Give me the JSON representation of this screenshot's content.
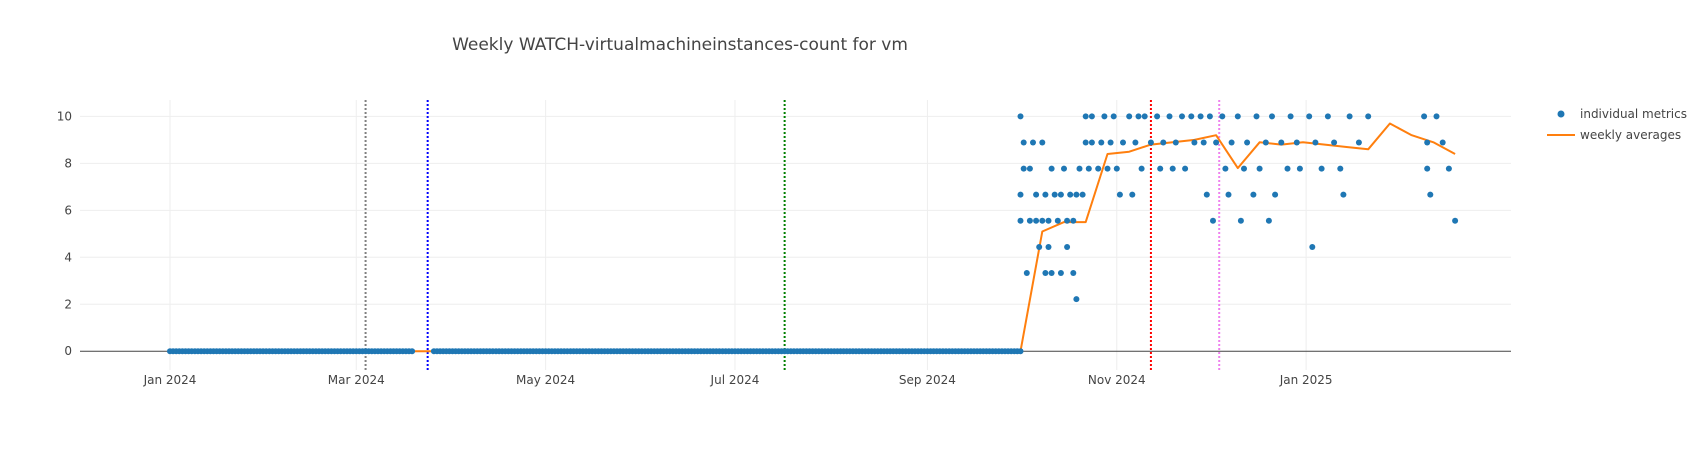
{
  "chart_data": {
    "type": "scatter",
    "title": "Weekly WATCH-virtualmachineinstances-count for vm",
    "xlabel": "",
    "ylabel": "",
    "x_axis": {
      "type": "date",
      "range": [
        "2023-12-03",
        "2025-03-08"
      ],
      "ticks": [
        {
          "date": "2024-01-01",
          "label": "Jan 2024"
        },
        {
          "date": "2024-03-01",
          "label": "Mar 2024"
        },
        {
          "date": "2024-05-01",
          "label": "May 2024"
        },
        {
          "date": "2024-07-01",
          "label": "Jul 2024"
        },
        {
          "date": "2024-09-01",
          "label": "Sep 2024"
        },
        {
          "date": "2024-11-01",
          "label": "Nov 2024"
        },
        {
          "date": "2025-01-01",
          "label": "Jan 2025"
        }
      ]
    },
    "y_axis": {
      "range": [
        -0.8,
        10.7
      ],
      "ticks": [
        0,
        2,
        4,
        6,
        8,
        10
      ]
    },
    "grid": true,
    "legend_position": "top-right",
    "series": [
      {
        "name": "individual metrics",
        "type": "scatter",
        "color": "#1f77b4",
        "zero_segments": [
          {
            "start": "2024-01-01",
            "end": "2024-03-19"
          },
          {
            "start": "2024-03-26",
            "end": "2024-10-01"
          }
        ],
        "points": [
          [
            "2024-10-01",
            10
          ],
          [
            "2024-10-01",
            5.56
          ],
          [
            "2024-10-01",
            6.67
          ],
          [
            "2024-10-02",
            8.89
          ],
          [
            "2024-10-02",
            7.78
          ],
          [
            "2024-10-03",
            3.33
          ],
          [
            "2024-10-04",
            7.78
          ],
          [
            "2024-10-04",
            5.56
          ],
          [
            "2024-10-05",
            8.89
          ],
          [
            "2024-10-06",
            6.67
          ],
          [
            "2024-10-06",
            5.56
          ],
          [
            "2024-10-07",
            4.44
          ],
          [
            "2024-10-08",
            8.89
          ],
          [
            "2024-10-08",
            5.56
          ],
          [
            "2024-10-09",
            3.33
          ],
          [
            "2024-10-09",
            6.67
          ],
          [
            "2024-10-10",
            5.56
          ],
          [
            "2024-10-10",
            4.44
          ],
          [
            "2024-10-11",
            7.78
          ],
          [
            "2024-10-11",
            3.33
          ],
          [
            "2024-10-12",
            6.67
          ],
          [
            "2024-10-13",
            5.56
          ],
          [
            "2024-10-14",
            6.67
          ],
          [
            "2024-10-14",
            3.33
          ],
          [
            "2024-10-15",
            7.78
          ],
          [
            "2024-10-16",
            5.56
          ],
          [
            "2024-10-16",
            4.44
          ],
          [
            "2024-10-17",
            6.67
          ],
          [
            "2024-10-18",
            5.56
          ],
          [
            "2024-10-18",
            3.33
          ],
          [
            "2024-10-19",
            2.22
          ],
          [
            "2024-10-19",
            6.67
          ],
          [
            "2024-10-20",
            7.78
          ],
          [
            "2024-10-21",
            6.67
          ],
          [
            "2024-10-22",
            8.89
          ],
          [
            "2024-10-22",
            10
          ],
          [
            "2024-10-23",
            7.78
          ],
          [
            "2024-10-24",
            10
          ],
          [
            "2024-10-24",
            8.89
          ],
          [
            "2024-10-26",
            7.78
          ],
          [
            "2024-10-27",
            8.89
          ],
          [
            "2024-10-28",
            10
          ],
          [
            "2024-10-29",
            7.78
          ],
          [
            "2024-10-30",
            8.89
          ],
          [
            "2024-10-31",
            10
          ],
          [
            "2024-11-01",
            7.78
          ],
          [
            "2024-11-02",
            6.67
          ],
          [
            "2024-11-03",
            8.89
          ],
          [
            "2024-11-05",
            10
          ],
          [
            "2024-11-06",
            6.67
          ],
          [
            "2024-11-07",
            8.89
          ],
          [
            "2024-11-08",
            10
          ],
          [
            "2024-11-09",
            7.78
          ],
          [
            "2024-11-10",
            10
          ],
          [
            "2024-11-12",
            8.89
          ],
          [
            "2024-11-14",
            10
          ],
          [
            "2024-11-15",
            7.78
          ],
          [
            "2024-11-16",
            8.89
          ],
          [
            "2024-11-18",
            10
          ],
          [
            "2024-11-19",
            7.78
          ],
          [
            "2024-11-20",
            8.89
          ],
          [
            "2024-11-22",
            10
          ],
          [
            "2024-11-23",
            7.78
          ],
          [
            "2024-11-25",
            10
          ],
          [
            "2024-11-26",
            8.89
          ],
          [
            "2024-11-28",
            10
          ],
          [
            "2024-11-29",
            8.89
          ],
          [
            "2024-11-30",
            6.67
          ],
          [
            "2024-12-01",
            10
          ],
          [
            "2024-12-02",
            5.56
          ],
          [
            "2024-12-03",
            8.89
          ],
          [
            "2024-12-05",
            10
          ],
          [
            "2024-12-06",
            7.78
          ],
          [
            "2024-12-07",
            6.67
          ],
          [
            "2024-12-08",
            8.89
          ],
          [
            "2024-12-10",
            10
          ],
          [
            "2024-12-11",
            5.56
          ],
          [
            "2024-12-12",
            7.78
          ],
          [
            "2024-12-13",
            8.89
          ],
          [
            "2024-12-15",
            6.67
          ],
          [
            "2024-12-16",
            10
          ],
          [
            "2024-12-17",
            7.78
          ],
          [
            "2024-12-19",
            8.89
          ],
          [
            "2024-12-20",
            5.56
          ],
          [
            "2024-12-21",
            10
          ],
          [
            "2024-12-22",
            6.67
          ],
          [
            "2024-12-24",
            8.89
          ],
          [
            "2024-12-26",
            7.78
          ],
          [
            "2024-12-27",
            10
          ],
          [
            "2024-12-29",
            8.89
          ],
          [
            "2024-12-30",
            7.78
          ],
          [
            "2025-01-02",
            10
          ],
          [
            "2025-01-03",
            4.44
          ],
          [
            "2025-01-04",
            8.89
          ],
          [
            "2025-01-06",
            7.78
          ],
          [
            "2025-01-08",
            10
          ],
          [
            "2025-01-10",
            8.89
          ],
          [
            "2025-01-12",
            7.78
          ],
          [
            "2025-01-13",
            6.67
          ],
          [
            "2025-01-15",
            10
          ],
          [
            "2025-01-18",
            8.89
          ],
          [
            "2025-01-21",
            10
          ],
          [
            "2025-02-08",
            10
          ],
          [
            "2025-02-09",
            8.89
          ],
          [
            "2025-02-09",
            7.78
          ],
          [
            "2025-02-10",
            6.67
          ],
          [
            "2025-02-12",
            10
          ],
          [
            "2025-02-14",
            8.89
          ],
          [
            "2025-02-16",
            7.78
          ],
          [
            "2025-02-18",
            5.56
          ]
        ]
      },
      {
        "name": "weekly averages",
        "type": "line",
        "color": "#ff7f0e",
        "x": [
          "2024-01-01",
          "2024-01-08",
          "2024-10-01",
          "2024-10-08",
          "2024-10-15",
          "2024-10-22",
          "2024-10-29",
          "2024-11-05",
          "2024-11-12",
          "2024-11-19",
          "2024-11-26",
          "2024-12-03",
          "2024-12-10",
          "2024-12-17",
          "2024-12-24",
          "2024-12-31",
          "2025-01-07",
          "2025-01-14",
          "2025-01-21",
          "2025-01-28",
          "2025-02-04",
          "2025-02-11",
          "2025-02-18"
        ],
        "y": [
          0,
          0,
          0,
          5.1,
          5.5,
          5.5,
          8.4,
          8.5,
          8.8,
          8.9,
          9.0,
          9.2,
          7.8,
          8.9,
          8.8,
          8.9,
          8.8,
          8.7,
          8.6,
          9.7,
          9.2,
          8.9,
          8.4
        ]
      }
    ],
    "vertical_lines": [
      {
        "date": "2024-03-04",
        "color": "#808080",
        "style": "dotted"
      },
      {
        "date": "2024-03-24",
        "color": "#0000ff",
        "style": "dotted"
      },
      {
        "date": "2024-07-17",
        "color": "#008000",
        "style": "dotted"
      },
      {
        "date": "2024-11-12",
        "color": "#ff0000",
        "style": "dotted"
      },
      {
        "date": "2024-12-04",
        "color": "#ee82ee",
        "style": "dotted"
      }
    ]
  }
}
